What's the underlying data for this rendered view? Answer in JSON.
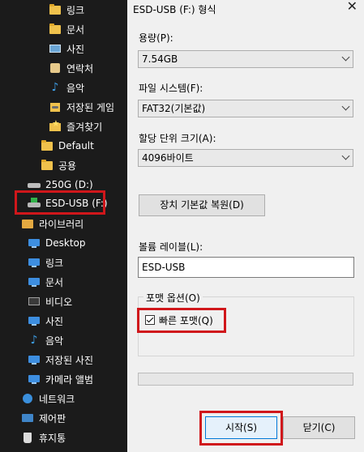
{
  "tree": {
    "items": [
      {
        "icon": "folder-icon",
        "label": "링크"
      },
      {
        "icon": "folder-icon",
        "label": "문서"
      },
      {
        "icon": "pictures-icon",
        "label": "사진"
      },
      {
        "icon": "contacts-icon",
        "label": "연락처"
      },
      {
        "icon": "music-icon",
        "label": "음악"
      },
      {
        "icon": "saved-games-icon",
        "label": "저장된 게임"
      },
      {
        "icon": "favorites-icon",
        "label": "즐겨찾기"
      },
      {
        "icon": "folder-icon",
        "label": "Default"
      },
      {
        "icon": "folder-icon",
        "label": "공용"
      },
      {
        "icon": "drive-icon",
        "label": "250G (D:)"
      },
      {
        "icon": "usb-drive-icon",
        "label": "ESD-USB (F:)"
      },
      {
        "icon": "library-icon",
        "label": "라이브러리"
      },
      {
        "icon": "desktop-icon",
        "label": "Desktop"
      },
      {
        "icon": "library-folder-icon",
        "label": "링크"
      },
      {
        "icon": "library-folder-icon",
        "label": "문서"
      },
      {
        "icon": "video-icon",
        "label": "비디오"
      },
      {
        "icon": "library-folder-icon",
        "label": "사진"
      },
      {
        "icon": "music-icon",
        "label": "음악"
      },
      {
        "icon": "library-folder-icon",
        "label": "저장된 사진"
      },
      {
        "icon": "camera-roll-icon",
        "label": "카메라 앨범"
      },
      {
        "icon": "network-icon",
        "label": "네트워크"
      },
      {
        "icon": "control-panel-icon",
        "label": "제어판"
      },
      {
        "icon": "recycle-bin-icon",
        "label": "휴지통"
      }
    ]
  },
  "dialog": {
    "title": "ESD-USB (F:) 형식",
    "close_glyph": "✕",
    "capacity_label": "용량(P):",
    "capacity_value": "7.54GB",
    "filesystem_label": "파일 시스템(F):",
    "filesystem_value": "FAT32(기본값)",
    "alloc_label": "할당 단위 크기(A):",
    "alloc_value": "4096바이트",
    "restore_button": "장치 기본값 복원(D)",
    "volume_label": "볼륨 레이블(L):",
    "volume_value": "ESD-USB",
    "options_title": "포맷 옵션(O)",
    "quick_format_label": "빠른 포맷(Q)",
    "quick_format_checked": true,
    "progress": 0,
    "start_button": "시작(S)",
    "close_button": "닫기(C)"
  },
  "colors": {
    "tree_bg": "#1b1b1b",
    "dialog_bg": "#f0f0f0",
    "highlight": "#d0171b"
  }
}
